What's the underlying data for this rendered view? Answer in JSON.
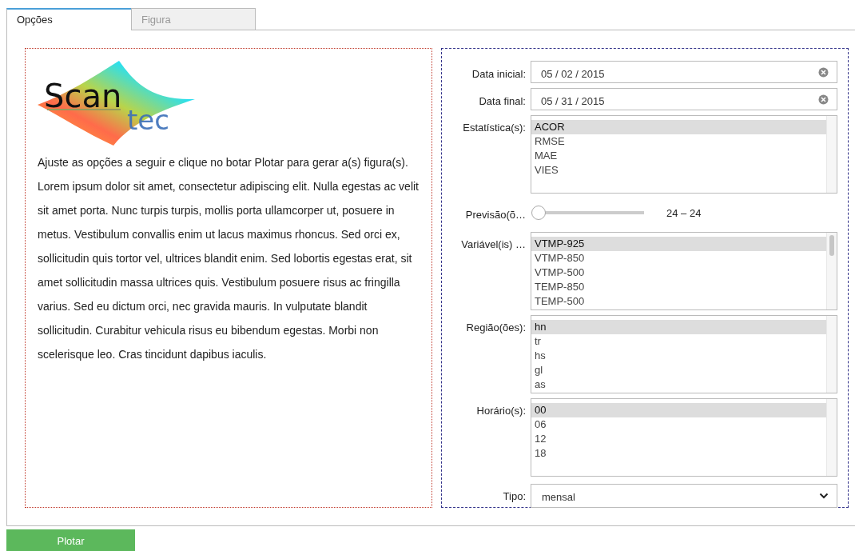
{
  "tabs": [
    {
      "label": "Opções",
      "selected": true
    },
    {
      "label": "Figura",
      "selected": false
    }
  ],
  "logo": {
    "word_1": "Scan",
    "word_2": "tec"
  },
  "intro": [
    "Ajuste as opções a seguir e clique no botar Plotar para gerar a(s) figura(s).",
    "Lorem ipsum dolor sit amet, consectetur adipiscing elit. Nulla egestas ac velit sit amet porta. Nunc turpis turpis, mollis porta ullamcorper ut, posuere in metus. Vestibulum convallis enim ut lacus maximus rhoncus. Sed orci ex, sollicitudin quis tortor vel, ultrices blandit enim. Sed lobortis egestas erat, sit amet sollicitudin massa ultrices quis. Vestibulum posuere risus ac fringilla varius. Sed eu dictum orci, nec gravida mauris. In vulputate blandit sollicitudin. Curabitur vehicula risus eu bibendum egestas. Morbi non scelerisque leo. Cras tincidunt dapibus iaculis."
  ],
  "form": [
    {
      "kind": "date",
      "label": "Data inicial:",
      "value": "05 / 02 / 2015"
    },
    {
      "kind": "date",
      "label": "Data final:",
      "value": "05 / 31 / 2015"
    },
    {
      "kind": "list",
      "label": "Estatística(s):",
      "scrollable": false,
      "items": [
        {
          "label": "ACOR",
          "selected": true
        },
        {
          "label": "RMSE",
          "selected": false
        },
        {
          "label": "MAE",
          "selected": false
        },
        {
          "label": "VIES",
          "selected": false
        }
      ]
    },
    {
      "kind": "slider",
      "label": "Previsão(õ…",
      "level": 0,
      "reading": "24 – 24"
    },
    {
      "kind": "list",
      "label": "Variável(is) …",
      "scrollable": true,
      "items": [
        {
          "label": "VTMP-925",
          "selected": true
        },
        {
          "label": "VTMP-850",
          "selected": false
        },
        {
          "label": "VTMP-500",
          "selected": false
        },
        {
          "label": "TEMP-850",
          "selected": false
        },
        {
          "label": "TEMP-500",
          "selected": false
        }
      ]
    },
    {
      "kind": "list",
      "label": "Região(ões):",
      "scrollable": false,
      "items": [
        {
          "label": "hn",
          "selected": true
        },
        {
          "label": "tr",
          "selected": false
        },
        {
          "label": "hs",
          "selected": false
        },
        {
          "label": "gl",
          "selected": false
        },
        {
          "label": "as",
          "selected": false
        }
      ]
    },
    {
      "kind": "list",
      "label": "Horário(s):",
      "scrollable": false,
      "items": [
        {
          "label": "00",
          "selected": true
        },
        {
          "label": "06",
          "selected": false
        },
        {
          "label": "12",
          "selected": false
        },
        {
          "label": "18",
          "selected": false
        }
      ]
    },
    {
      "kind": "select",
      "label": "Tipo:",
      "value": "mensal"
    }
  ],
  "plot_button": "Plotar"
}
